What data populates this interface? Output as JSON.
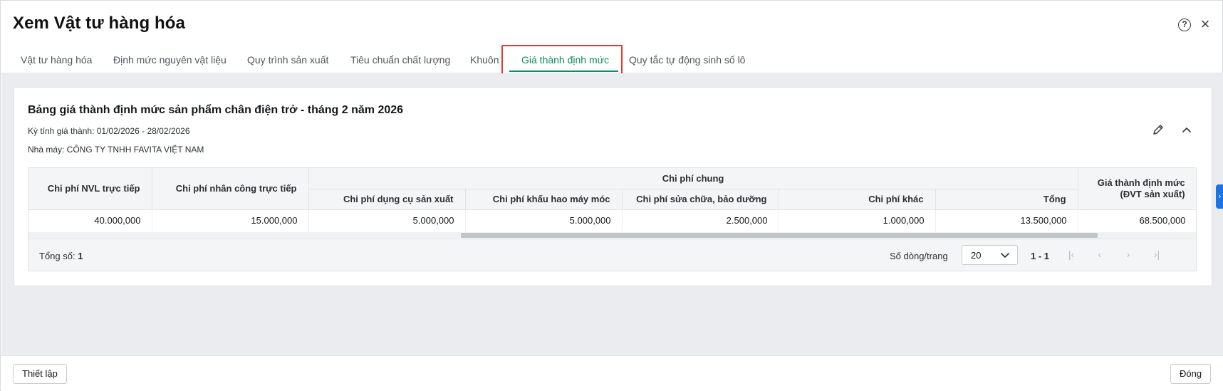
{
  "dialog": {
    "title": "Xem Vật tư hàng hóa"
  },
  "tabs": [
    {
      "label": "Vật tư hàng hóa"
    },
    {
      "label": "Định mức nguyên vật liệu"
    },
    {
      "label": "Quy trình sản xuất"
    },
    {
      "label": "Tiêu chuẩn chất lượng"
    },
    {
      "label": "Khuôn"
    },
    {
      "label": "Giá thành định mức",
      "active": true
    },
    {
      "label": "Quy tắc tự động sinh số lô"
    }
  ],
  "card": {
    "title": "Bảng giá thành định mức sản phẩm chân điện trở - tháng 2 năm 2026",
    "period": "Kỳ tính giá thành: 01/02/2026 - 28/02/2026",
    "factory": "Nhà máy: CÔNG TY TNHH FAVITA VIỆT NAM"
  },
  "table": {
    "headers": {
      "nvl": "Chi phí NVL trực tiếp",
      "nhan_cong": "Chi phí nhân công trực tiếp",
      "chung": "Chi phí chung",
      "dung_cu": "Chi phí dụng cụ sản xuất",
      "khau_hao": "Chi phí khấu hao máy móc",
      "sua_chua": "Chi phí sửa chữa, bảo dưỡng",
      "khac": "Chi phí khác",
      "tong": "Tổng",
      "gia_thanh_line1": "Giá thành định mức",
      "gia_thanh_line2": "(ĐVT sản xuất)"
    },
    "rows": [
      {
        "nvl": "40.000,000",
        "nhan_cong": "15.000,000",
        "dung_cu": "5.000,000",
        "khau_hao": "5.000,000",
        "sua_chua": "2.500,000",
        "khac": "1.000,000",
        "tong": "13.500,000",
        "gia_thanh": "68.500,000"
      }
    ]
  },
  "pager": {
    "total_label": "Tổng số:",
    "total_value": "1",
    "rows_per_page_label": "Số dòng/trang",
    "rows_per_page": "20",
    "range": "1 - 1"
  },
  "footer": {
    "setup_label": "Thiết lập",
    "close_label": "Đóng"
  },
  "colors": {
    "accent": "#0f8a5f",
    "highlight": "#e0392f",
    "side_tab": "#1a73e8"
  }
}
